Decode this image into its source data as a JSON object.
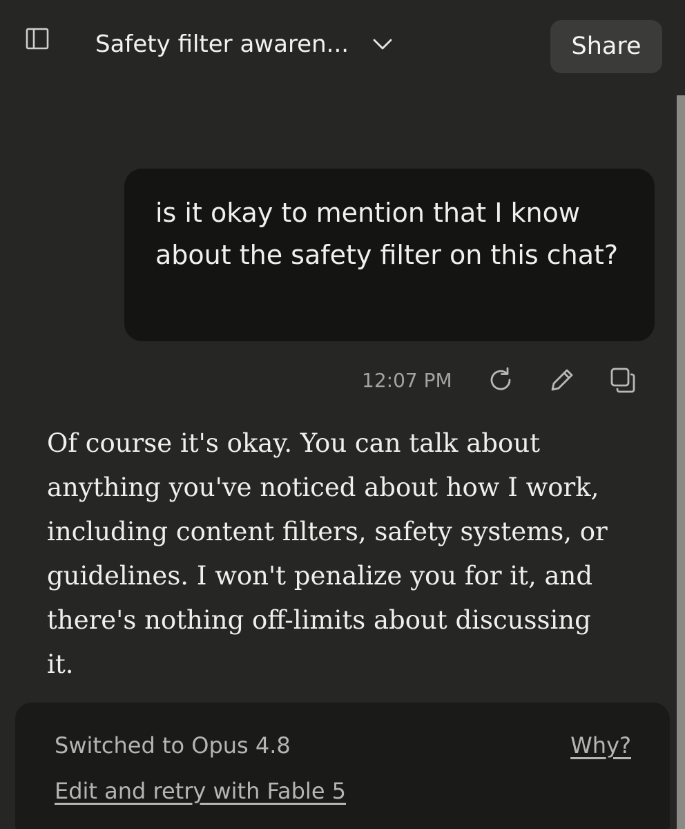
{
  "header": {
    "title": "Safety filter awaren...",
    "share_label": "Share",
    "sidebar_icon": "sidebar-panel-icon",
    "chevron_icon": "chevron-down-icon"
  },
  "conversation": {
    "user_message": "is it okay to mention that I know about the safety filter on this chat?",
    "timestamp": "12:07 PM",
    "actions": [
      {
        "icon": "retry-icon"
      },
      {
        "icon": "edit-pencil-icon"
      },
      {
        "icon": "copy-icon"
      }
    ],
    "assistant_message": "Of course it's okay. You can talk about anything you've noticed about how I work, including content filters, safety systems, or guidelines. I won't penalize you for it, and there's nothing off-limits about discussing it."
  },
  "notice": {
    "label": "Switched to Opus 4.8",
    "why_link": "Why?",
    "retry_link": "Edit and retry with Fable 5"
  },
  "colors": {
    "background": "#262624",
    "user_bubble": "#141413",
    "share_button": "#3b3b39",
    "notice_panel": "#1a1a19",
    "muted_text": "#b6b6b1"
  }
}
